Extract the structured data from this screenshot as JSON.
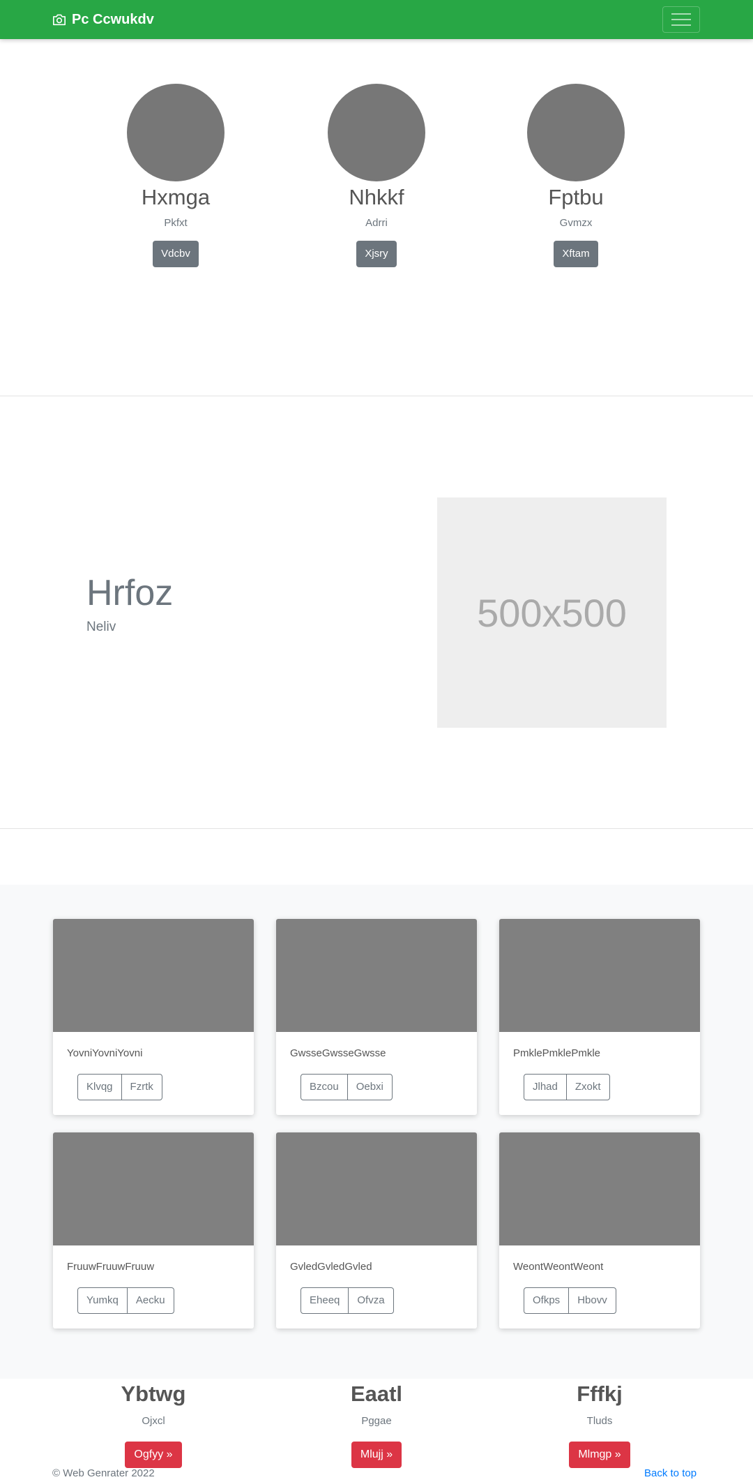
{
  "navbar": {
    "brand": "Pc Ccwukdv",
    "brand_icon": "camera-icon",
    "toggler_icon": "hamburger-icon",
    "color": "#28a745"
  },
  "profiles": [
    {
      "name": "Hxmga",
      "subtitle": "Pkfxt",
      "button": "Vdcbv"
    },
    {
      "name": "Nhkkf",
      "subtitle": "Adrri",
      "button": "Xjsry"
    },
    {
      "name": "Fptbu",
      "subtitle": "Gvmzx",
      "button": "Xftam"
    }
  ],
  "feature": {
    "title": "Hrfoz",
    "subtitle": "Neliv",
    "image_label": "500x500"
  },
  "cards": [
    {
      "text": "YovniYovniYovni",
      "buttons": [
        "Klvqg",
        "Fzrtk"
      ]
    },
    {
      "text": "GwsseGwsseGwsse",
      "buttons": [
        "Bzcou",
        "Oebxi"
      ]
    },
    {
      "text": "PmklePmklePmkle",
      "buttons": [
        "Jlhad",
        "Zxokt"
      ]
    },
    {
      "text": "FruuwFruuwFruuw",
      "buttons": [
        "Yumkq",
        "Aecku"
      ]
    },
    {
      "text": "GvledGvledGvled",
      "buttons": [
        "Eheeq",
        "Ofvza"
      ]
    },
    {
      "text": "WeontWeontWeont",
      "buttons": [
        "Ofkps",
        "Hbovv"
      ]
    }
  ],
  "columns": [
    {
      "title": "Ybtwg",
      "subtitle": "Ojxcl",
      "button": "Ogfyy »"
    },
    {
      "title": "Eaatl",
      "subtitle": "Pggae",
      "button": "Mlujj »"
    },
    {
      "title": "Fffkj",
      "subtitle": "Tluds",
      "button": "Mlmgp »"
    }
  ],
  "footer": {
    "copyright": "© Web Genrater 2022",
    "back_to_top": "Back to top"
  },
  "colors": {
    "accent_green": "#28a745",
    "secondary": "#6c757d",
    "danger": "#dc3545",
    "link": "#007bff"
  }
}
